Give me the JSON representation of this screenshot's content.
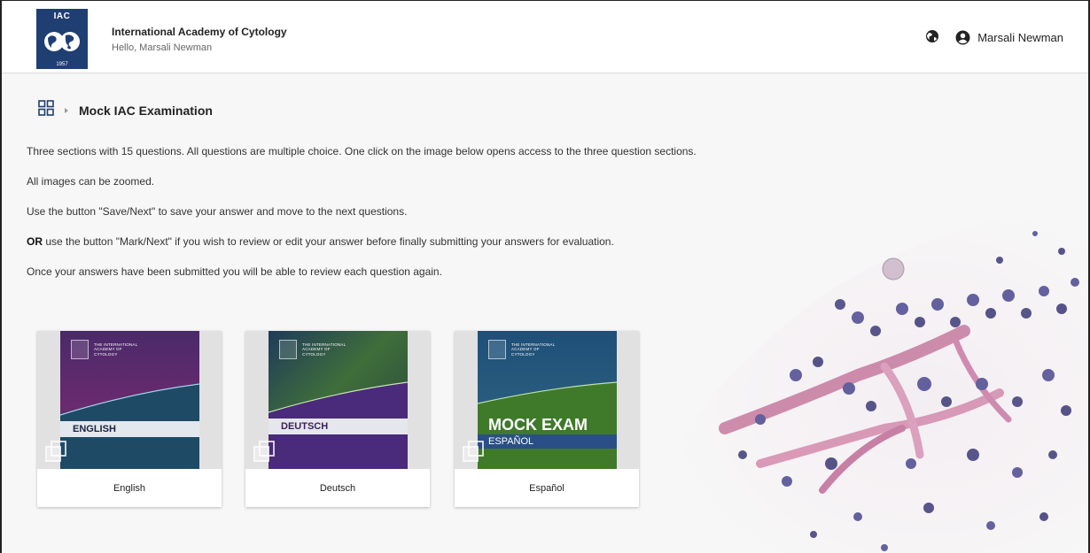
{
  "header": {
    "org_name": "International Academy of Cytology",
    "greeting": "Hello, Marsali Newman",
    "user_name": "Marsali Newman",
    "logo_text": "IAC",
    "logo_year": "1957"
  },
  "breadcrumb": {
    "title": "Mock IAC Examination"
  },
  "instructions": {
    "p1": "Three sections with 15 questions. All questions are multiple choice. One click on the image below opens access to the three question sections.",
    "p2": "All images can be zoomed.",
    "p3": "Use the button \"Save/Next\" to save your answer and move to the next questions.",
    "p4_bold": "OR",
    "p4_rest": " use the  button \"Mark/Next\" if you wish to review or edit your answer before finally submitting your answers for evaluation.",
    "p5": "Once your answers have been submitted you will be able to review each question again."
  },
  "cards": [
    {
      "label": "English",
      "band": "ENGLISH",
      "color_top": "#5a2a6e",
      "color_bottom": "#1e4463"
    },
    {
      "label": "Deutsch",
      "band": "DEUTSCH",
      "color_top": "#2d5a3a",
      "color_bottom": "#4a2675"
    },
    {
      "label": "Español",
      "band_main": "MOCK EXAM",
      "band_sub": "ESPAÑOL",
      "color_top": "#1f4f78",
      "color_bottom": "#3f7a2a"
    }
  ],
  "cover_caption": "THE INTERNATIONAL ACADEMY OF CYTOLOGY",
  "icons": {
    "globe": "globe-icon",
    "user": "user-circle-icon",
    "dashboard": "grid-icon",
    "chevron": "chevron-right-icon",
    "copy": "copy-icon"
  },
  "colors": {
    "brand": "#1f3f73",
    "background": "#f7f7f7"
  }
}
